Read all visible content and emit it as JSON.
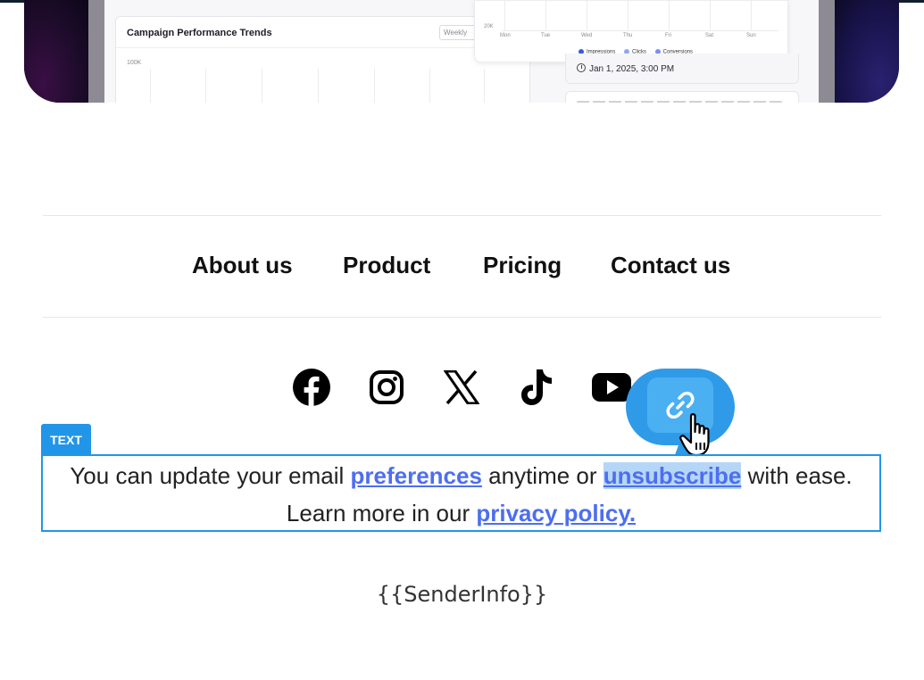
{
  "hero": {
    "chart_title": "Campaign Performance Trends",
    "period_select": "Weekly",
    "y_tick_top": "100K",
    "mini_y_tick": "20K",
    "days": [
      "Mon",
      "Tue",
      "Wed",
      "Thu",
      "Fri",
      "Sat",
      "Sun"
    ],
    "legend": [
      {
        "label": "Impressions",
        "color": "#3b5bdb"
      },
      {
        "label": "Clicks",
        "color": "#8fa8f5"
      },
      {
        "label": "Conversions",
        "color": "#7b8ff0"
      }
    ],
    "date": "Jan 1, 2025, 3:00 PM"
  },
  "nav": {
    "items": [
      "About us",
      "Product",
      "Pricing",
      "Contact us"
    ]
  },
  "social": {
    "icons": [
      "facebook-icon",
      "instagram-icon",
      "x-icon",
      "tiktok-icon",
      "youtube-icon"
    ]
  },
  "text_block": {
    "tag": "TEXT",
    "line1_prefix": "You can update your email ",
    "preferences_link": "preferences",
    "line1_mid": " anytime or ",
    "unsubscribe_link": "unsubscribe",
    "line1_suffix": " with ease.",
    "line2_prefix": "Learn more in our ",
    "privacy_link": "privacy policy."
  },
  "link_popup": {
    "icon": "link-icon"
  },
  "footer": {
    "sender": "{{SenderInfo}}"
  },
  "colors": {
    "accent": "#2196e8",
    "link": "#4d6ef0",
    "selection": "#b6d6f8"
  }
}
